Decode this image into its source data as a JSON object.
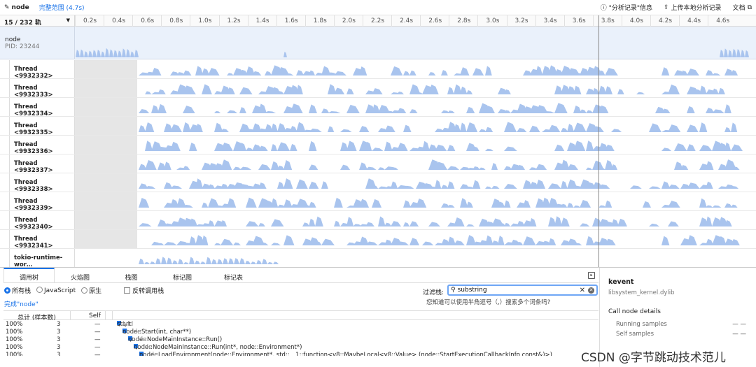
{
  "topbar": {
    "title": "node",
    "range_label": "完整范围 (4.7s)",
    "actions": [
      "\"分析记录\"信息",
      "上传本地分析记录",
      "文档"
    ]
  },
  "timeline": {
    "track_count": "15 / 232 轨",
    "ticks": [
      "0.2s",
      "0.4s",
      "0.6s",
      "0.8s",
      "1.0s",
      "1.2s",
      "1.4s",
      "1.6s",
      "1.8s",
      "2.0s",
      "2.2s",
      "2.4s",
      "2.6s",
      "2.8s",
      "3.0s",
      "3.2s",
      "3.4s",
      "3.6s",
      "3.8s",
      "4.0s",
      "4.2s",
      "4.4s",
      "4.6s"
    ]
  },
  "process": {
    "name": "node",
    "pid": "PID: 23244"
  },
  "threads": [
    "Thread <9932332>",
    "Thread <9932333>",
    "Thread <9932334>",
    "Thread <9932335>",
    "Thread <9932336>",
    "Thread <9932337>",
    "Thread <9932338>",
    "Thread <9932339>",
    "Thread <9932340>",
    "Thread <9932341>",
    "tokio-runtime-wor…"
  ],
  "colors": {
    "accent": "#1a73e8",
    "activity": "#a9c4ee"
  },
  "bottom": {
    "tabs": [
      "调用树",
      "火焰图",
      "栈图",
      "标记图",
      "标记表"
    ],
    "active_tab": "调用树",
    "radios": [
      "所有栈",
      "JavaScript",
      "原生"
    ],
    "invert_label": "反转调用栈",
    "filter_label": "过滤栈:",
    "filter_value": "substring",
    "filter_hint": "您知道可以使用半角逗号（,）搜索多个词条吗?",
    "status": "完成\"node\"",
    "columns": {
      "total": "总计 (样本数)",
      "self": "Self"
    },
    "rows": [
      {
        "pct": "100%",
        "count": "3",
        "self": "—",
        "name": "start",
        "lib": "dyld",
        "depth": 0
      },
      {
        "pct": "100%",
        "count": "3",
        "self": "—",
        "name": "node::Start(int, char**)",
        "lib": "node",
        "depth": 1
      },
      {
        "pct": "100%",
        "count": "3",
        "self": "—",
        "name": "node::NodeMainInstance::Run()",
        "lib": "node",
        "depth": 2
      },
      {
        "pct": "100%",
        "count": "3",
        "self": "—",
        "name": "node::NodeMainInstance::Run(int*, node::Environment*)",
        "lib": "node",
        "depth": 3
      },
      {
        "pct": "100%",
        "count": "3",
        "self": "—",
        "name": "node::LoadEnvironment(node::Environment*, std::__1::function<v8::MaybeLocal<v8::Value> (node::StartExecutionCallbackInfo const&)>)",
        "lib": "node",
        "depth": 4
      }
    ]
  },
  "side": {
    "function": "kevent",
    "library": "libsystem_kernel.dylib",
    "details_title": "Call node details",
    "running_label": "Running samples",
    "running_value": "— —",
    "self_label": "Self samples",
    "self_value": "— —"
  },
  "watermark": "CSDN @字节跳动技术范儿"
}
